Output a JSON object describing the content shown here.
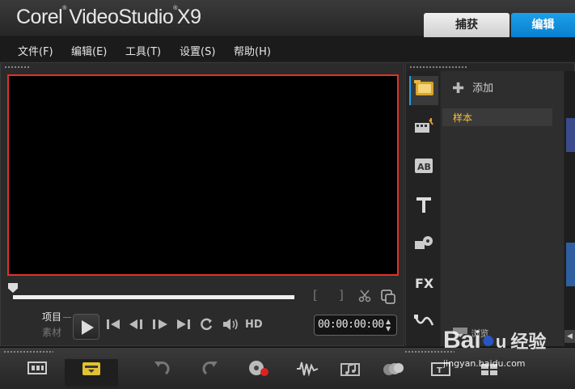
{
  "app": {
    "title_brand": "Corel",
    "title_product": "VideoStudio",
    "title_version": "X9"
  },
  "tabs": [
    {
      "label": "捕获",
      "active": false
    },
    {
      "label": "编辑",
      "active": true
    }
  ],
  "menu": [
    {
      "label": "文件(F)"
    },
    {
      "label": "编辑(E)"
    },
    {
      "label": "工具(T)"
    },
    {
      "label": "设置(S)"
    },
    {
      "label": "帮助(H)"
    }
  ],
  "player": {
    "mode_project": "项目",
    "mode_clip": "素材",
    "hd_label": "HD",
    "timecode": "00:00:00:00",
    "mark_in": "[",
    "mark_out": "]"
  },
  "library": {
    "add_label": "添加",
    "folders": [
      {
        "label": "样本",
        "selected": true
      }
    ],
    "browse_label": "浏览",
    "toolbar_icons": [
      "media-icon",
      "instant-project-icon",
      "transition-icon",
      "title-icon",
      "graphic-icon",
      "filter-icon",
      "path-icon"
    ]
  },
  "bottom_toolbar": {
    "icons": [
      "storyboard-view-icon",
      "timeline-view-icon",
      "undo-icon",
      "redo-icon",
      "record-capture-icon",
      "sound-mixer-icon",
      "auto-music-icon",
      "motion-tracking-icon",
      "subtitle-editor-icon",
      "multi-camera-icon"
    ]
  },
  "colors": {
    "accent": "#1c9fe8",
    "preview_highlight": "#e0322a",
    "folder_label": "#f2c23a"
  },
  "watermark": {
    "brand_left": "Bai",
    "brand_right": "经验",
    "url": "jingyan.baidu.com"
  }
}
